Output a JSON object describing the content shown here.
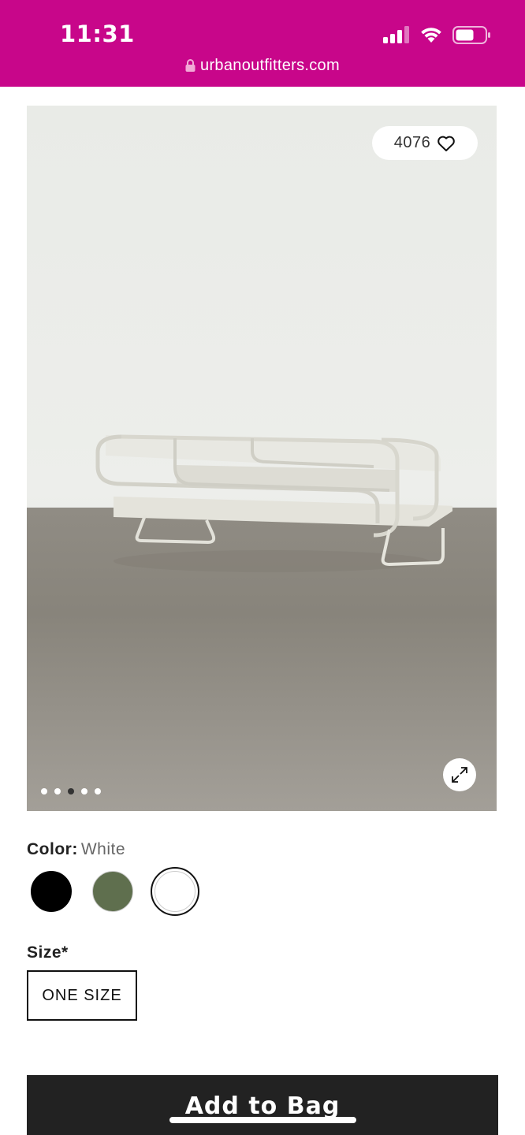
{
  "status_bar": {
    "time": "11:31"
  },
  "browser": {
    "url": "urbanoutfitters.com"
  },
  "product_image": {
    "like_count": "4076",
    "carousel": {
      "total": 5,
      "active_index": 3
    }
  },
  "color": {
    "label": "Color:",
    "selected": "White",
    "swatches": [
      "black",
      "olive",
      "white"
    ]
  },
  "size": {
    "label": "Size*",
    "option": "ONE SIZE"
  },
  "cta": {
    "add_to_bag": "Add to Bag"
  },
  "colors": {
    "brand": "#c8068a",
    "button": "#222222"
  }
}
